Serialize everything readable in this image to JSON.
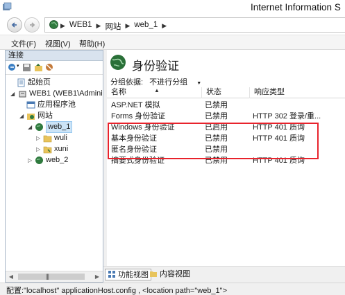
{
  "window": {
    "title": "Internet Information S"
  },
  "address": {
    "crumbs": [
      "WEB1",
      "网站",
      "web_1"
    ]
  },
  "menu": {
    "items": [
      "文件(F)",
      "视图(V)",
      "帮助(H)"
    ]
  },
  "connections": {
    "header": "连接",
    "tree": [
      {
        "label": "起始页",
        "icon": "start-page-icon"
      },
      {
        "label": "WEB1 (WEB1\\Adminis",
        "icon": "server-icon"
      },
      {
        "label": "应用程序池",
        "icon": "app-pool-icon"
      },
      {
        "label": "网站",
        "icon": "sites-folder-icon"
      },
      {
        "label": "web_1",
        "icon": "globe-icon"
      },
      {
        "label": "wuli",
        "icon": "folder-icon"
      },
      {
        "label": "xuni",
        "icon": "virtual-dir-icon"
      },
      {
        "label": "web_2",
        "icon": "globe-icon"
      }
    ]
  },
  "feature": {
    "title": "身份验证",
    "group_by_label": "分组依据:",
    "group_by_value": "不进行分组",
    "columns": [
      "名称",
      "状态",
      "响应类型"
    ],
    "rows": [
      {
        "name": "ASP.NET 模拟",
        "status": "已禁用",
        "response": ""
      },
      {
        "name": "Forms 身份验证",
        "status": "已禁用",
        "response": "HTTP 302 登录/重..."
      },
      {
        "name": "Windows 身份验证",
        "status": "已启用",
        "response": "HTTP 401 质询"
      },
      {
        "name": "基本身份验证",
        "status": "已禁用",
        "response": "HTTP 401 质询"
      },
      {
        "name": "匿名身份验证",
        "status": "已禁用",
        "response": ""
      },
      {
        "name": "摘要式身份验证",
        "status": "已禁用",
        "response": "HTTP 401 质询"
      }
    ]
  },
  "view_tabs": {
    "features": "功能视图",
    "content": "内容视图"
  },
  "status": {
    "text": "配置:\"localhost\" applicationHost.config , <location path=\"web_1\">"
  },
  "colors": {
    "highlight": "#e8232c",
    "selection": "#cce4f7",
    "pane_header": "#d9e3ee"
  }
}
